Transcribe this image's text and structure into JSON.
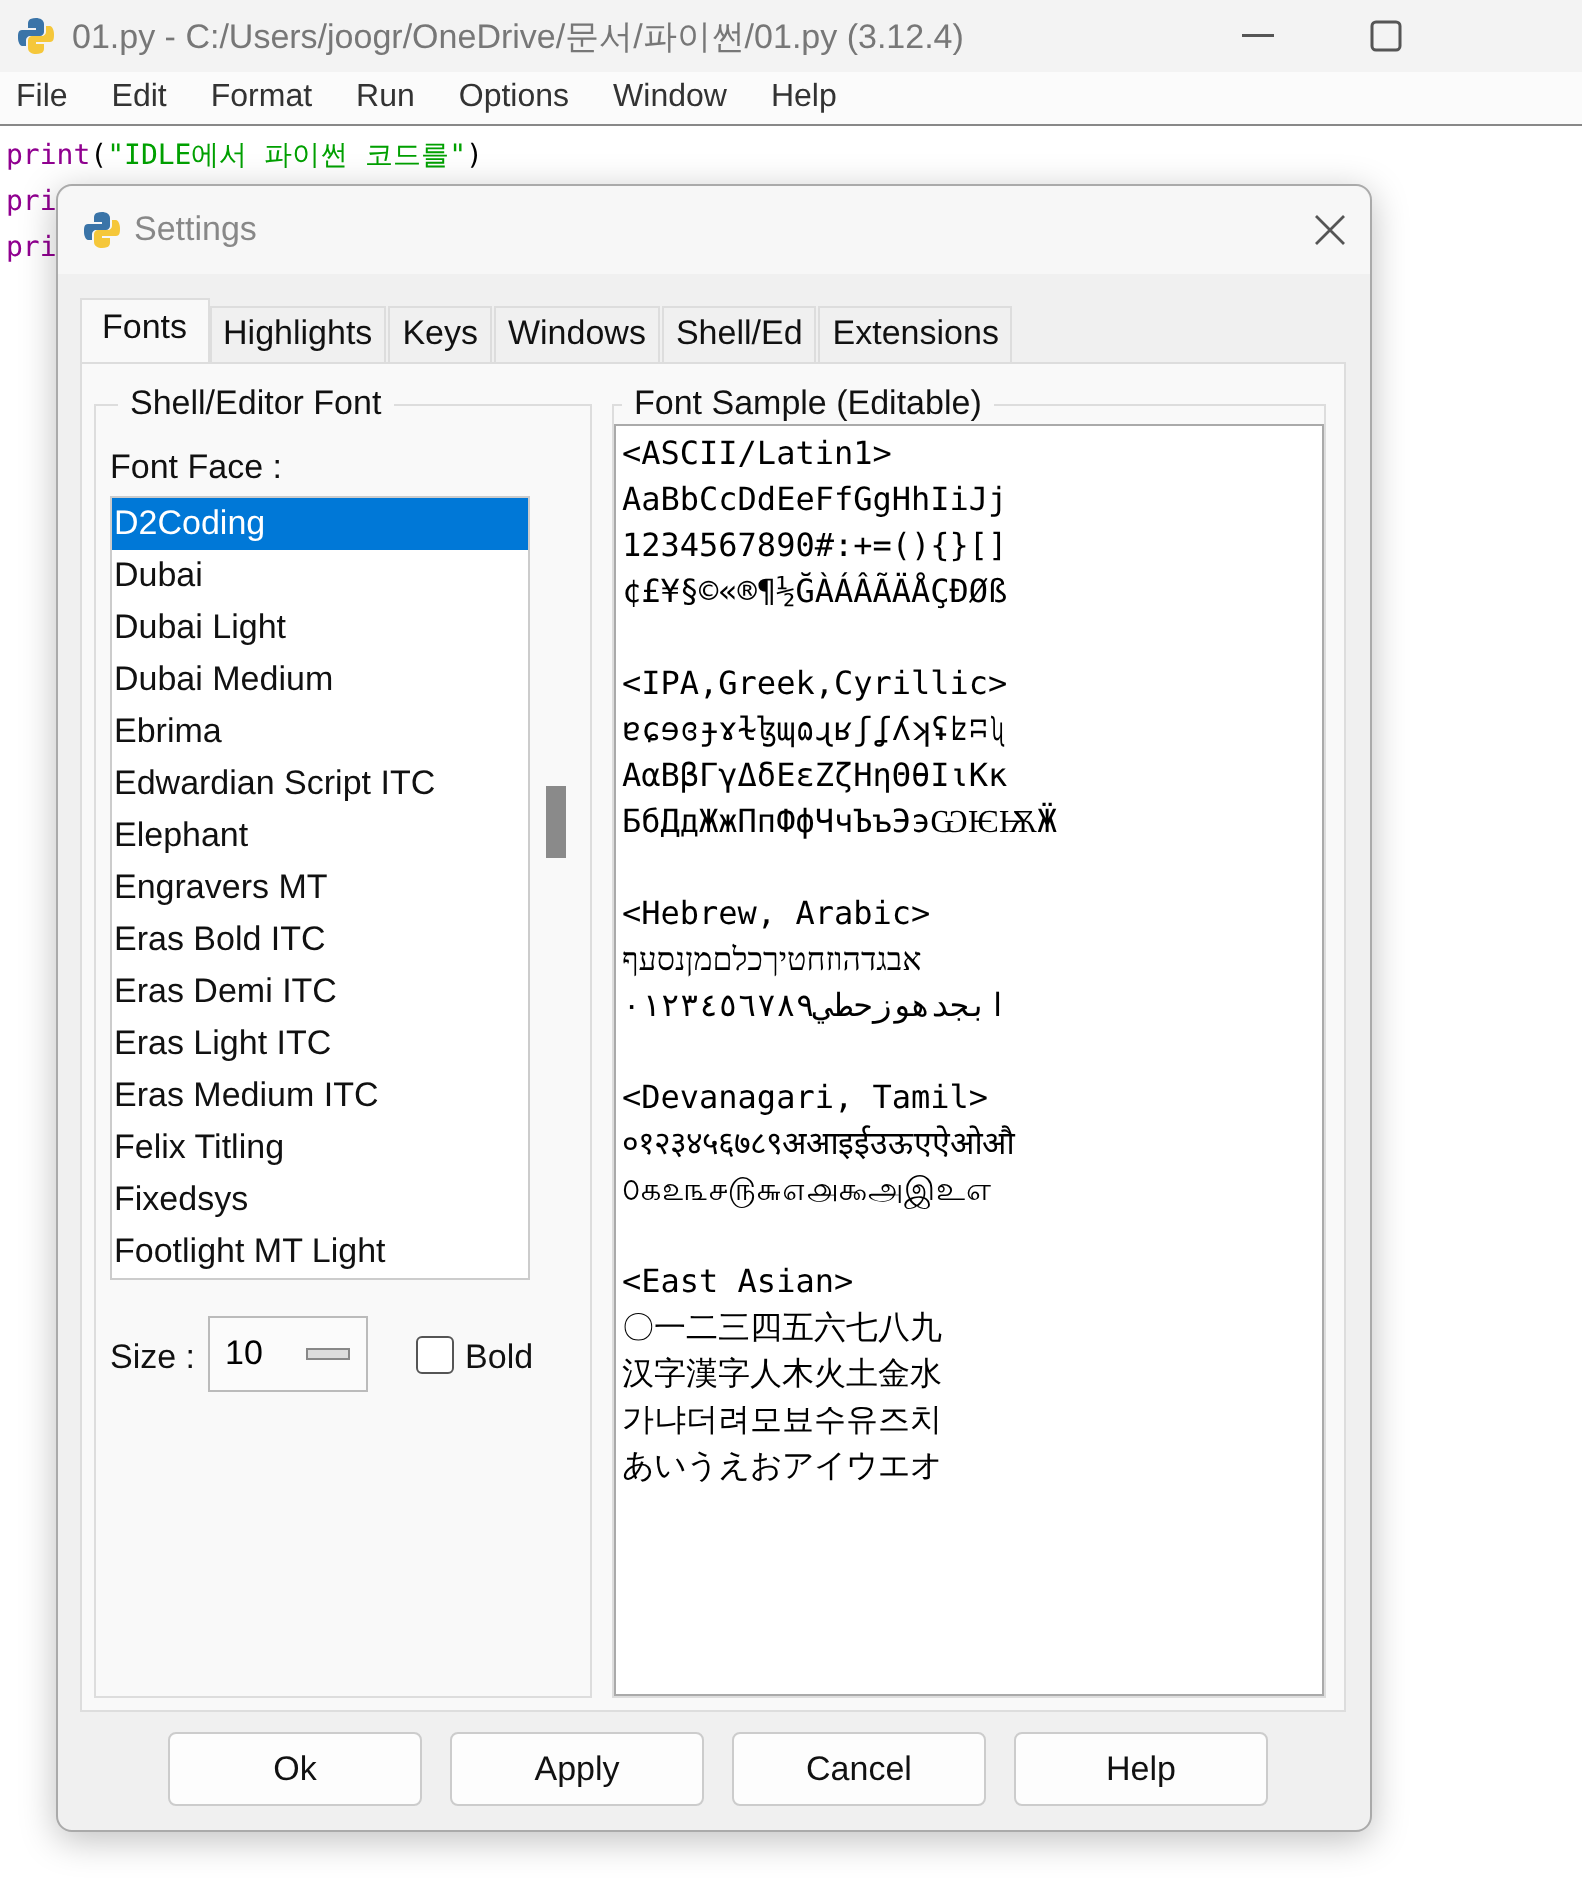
{
  "window": {
    "title": "01.py - C:/Users/joogr/OneDrive/문서/파이썬/01.py (3.12.4)"
  },
  "menu": [
    "File",
    "Edit",
    "Format",
    "Run",
    "Options",
    "Window",
    "Help"
  ],
  "code_lines": [
    {
      "keyword": "print",
      "rest": "(",
      "string": "\"IDLE에서 파이썬 코드를\"",
      "close": ")"
    },
    {
      "keyword": "pri"
    },
    {
      "keyword": "pri"
    }
  ],
  "dialog": {
    "title": "Settings",
    "tabs": [
      {
        "label": "Fonts",
        "selected": true
      },
      {
        "label": "Highlights",
        "selected": false
      },
      {
        "label": "Keys",
        "selected": false
      },
      {
        "label": "Windows",
        "selected": false
      },
      {
        "label": "Shell/Ed",
        "selected": false
      },
      {
        "label": "Extensions",
        "selected": false
      }
    ],
    "font_frame": {
      "title": "Shell/Editor Font",
      "face_label": "Font Face :",
      "fonts": [
        {
          "name": "D2Coding",
          "selected": true
        },
        {
          "name": "Dubai",
          "selected": false
        },
        {
          "name": "Dubai Light",
          "selected": false
        },
        {
          "name": "Dubai Medium",
          "selected": false
        },
        {
          "name": "Ebrima",
          "selected": false
        },
        {
          "name": "Edwardian Script ITC",
          "selected": false
        },
        {
          "name": "Elephant",
          "selected": false
        },
        {
          "name": "Engravers MT",
          "selected": false
        },
        {
          "name": "Eras Bold ITC",
          "selected": false
        },
        {
          "name": "Eras Demi ITC",
          "selected": false
        },
        {
          "name": "Eras Light ITC",
          "selected": false
        },
        {
          "name": "Eras Medium ITC",
          "selected": false
        },
        {
          "name": "Felix Titling",
          "selected": false
        },
        {
          "name": "Fixedsys",
          "selected": false
        },
        {
          "name": "Footlight MT Light",
          "selected": false
        }
      ],
      "size_label": "Size :",
      "size_value": "10",
      "bold": {
        "label": "Bold",
        "checked": false
      }
    },
    "sample_frame": {
      "title": "Font Sample (Editable)",
      "sections": [
        {
          "heading": "<ASCII/Latin1>",
          "lines": [
            "AaBbCcDdEeFfGgHhIiJj",
            "1234567890#:+=(){}[]",
            "¢£¥§©«®¶½ĞÀÁÂÃÄÅÇÐØß"
          ]
        },
        {
          "heading": "<IPA,Greek,Cyrillic>",
          "lines": [
            "ɐɕɘɞɟɤɫɮɰɷɻʁʃʆʎʞʢʫʭʯ",
            "ΑαΒβΓγΔδΕεΖζΗηΘθΙιΚκ",
            "БбДдЖжПпФфЧчЪъЭэѠѤѬӜ"
          ]
        },
        {
          "heading": "<Hebrew, Arabic>",
          "lines": [
            "אבגדהוזחטיךכלםמןנסעף",
            "ابجدهوزحطي٠١٢٣٤٥٦٧٨٩"
          ]
        },
        {
          "heading": "<Devanagari, Tamil>",
          "lines": [
            "०१२३४५६७८९अआइईउऊएऐओऔ",
            "௦௧௨௩௪௫௬௭௮௯அஇஉஎ"
          ]
        },
        {
          "heading": "<East Asian>",
          "lines": [
            "〇一二三四五六七八九",
            "汉字漢字人木火土金水",
            "가냐더려모뵤수유즈치",
            "あいうえおアイウエオ"
          ]
        }
      ]
    },
    "buttons": [
      "Ok",
      "Apply",
      "Cancel",
      "Help"
    ]
  }
}
